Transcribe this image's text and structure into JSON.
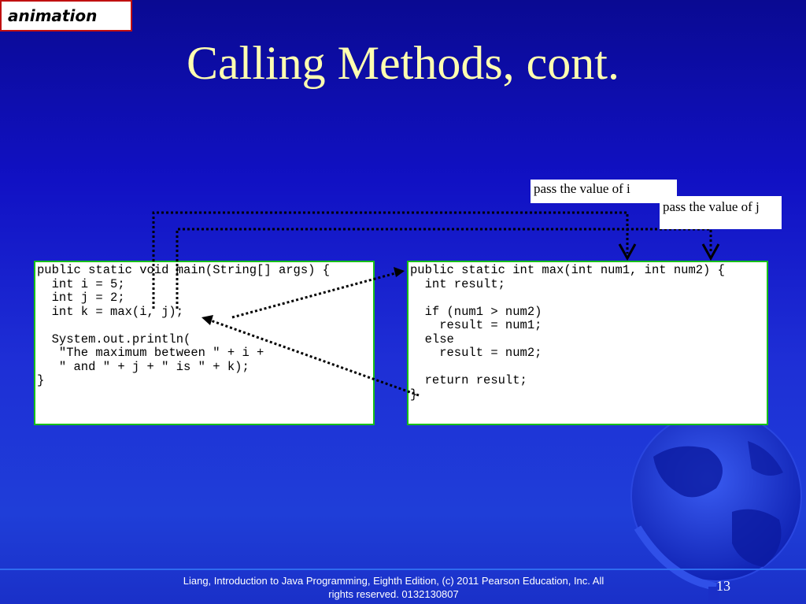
{
  "badge": {
    "label": "animation"
  },
  "slide": {
    "title": "Calling Methods, cont."
  },
  "code": {
    "main": "public static void main(String[] args) {\n  int i = 5;\n  int j = 2;\n  int k = max(i, j);\n\n  System.out.println(\n   \"The maximum between \" + i +\n   \" and \" + j + \" is \" + k);\n}",
    "max": "public static int max(int num1, int num2) {\n  int result;\n\n  if (num1 > num2)\n    result = num1;\n  else\n    result = num2;\n\n  return result;\n}"
  },
  "callouts": {
    "i": "pass the value of i",
    "j": "pass the value of j"
  },
  "footer": {
    "line1": "Liang, Introduction to Java Programming, Eighth Edition, (c) 2011 Pearson Education, Inc. All",
    "line2": "rights reserved. 0132130807",
    "page": "13"
  },
  "colors": {
    "background": "#1111c4",
    "title": "#ffffb0",
    "code_border": "#18c018",
    "badge_border": "#c01010"
  }
}
